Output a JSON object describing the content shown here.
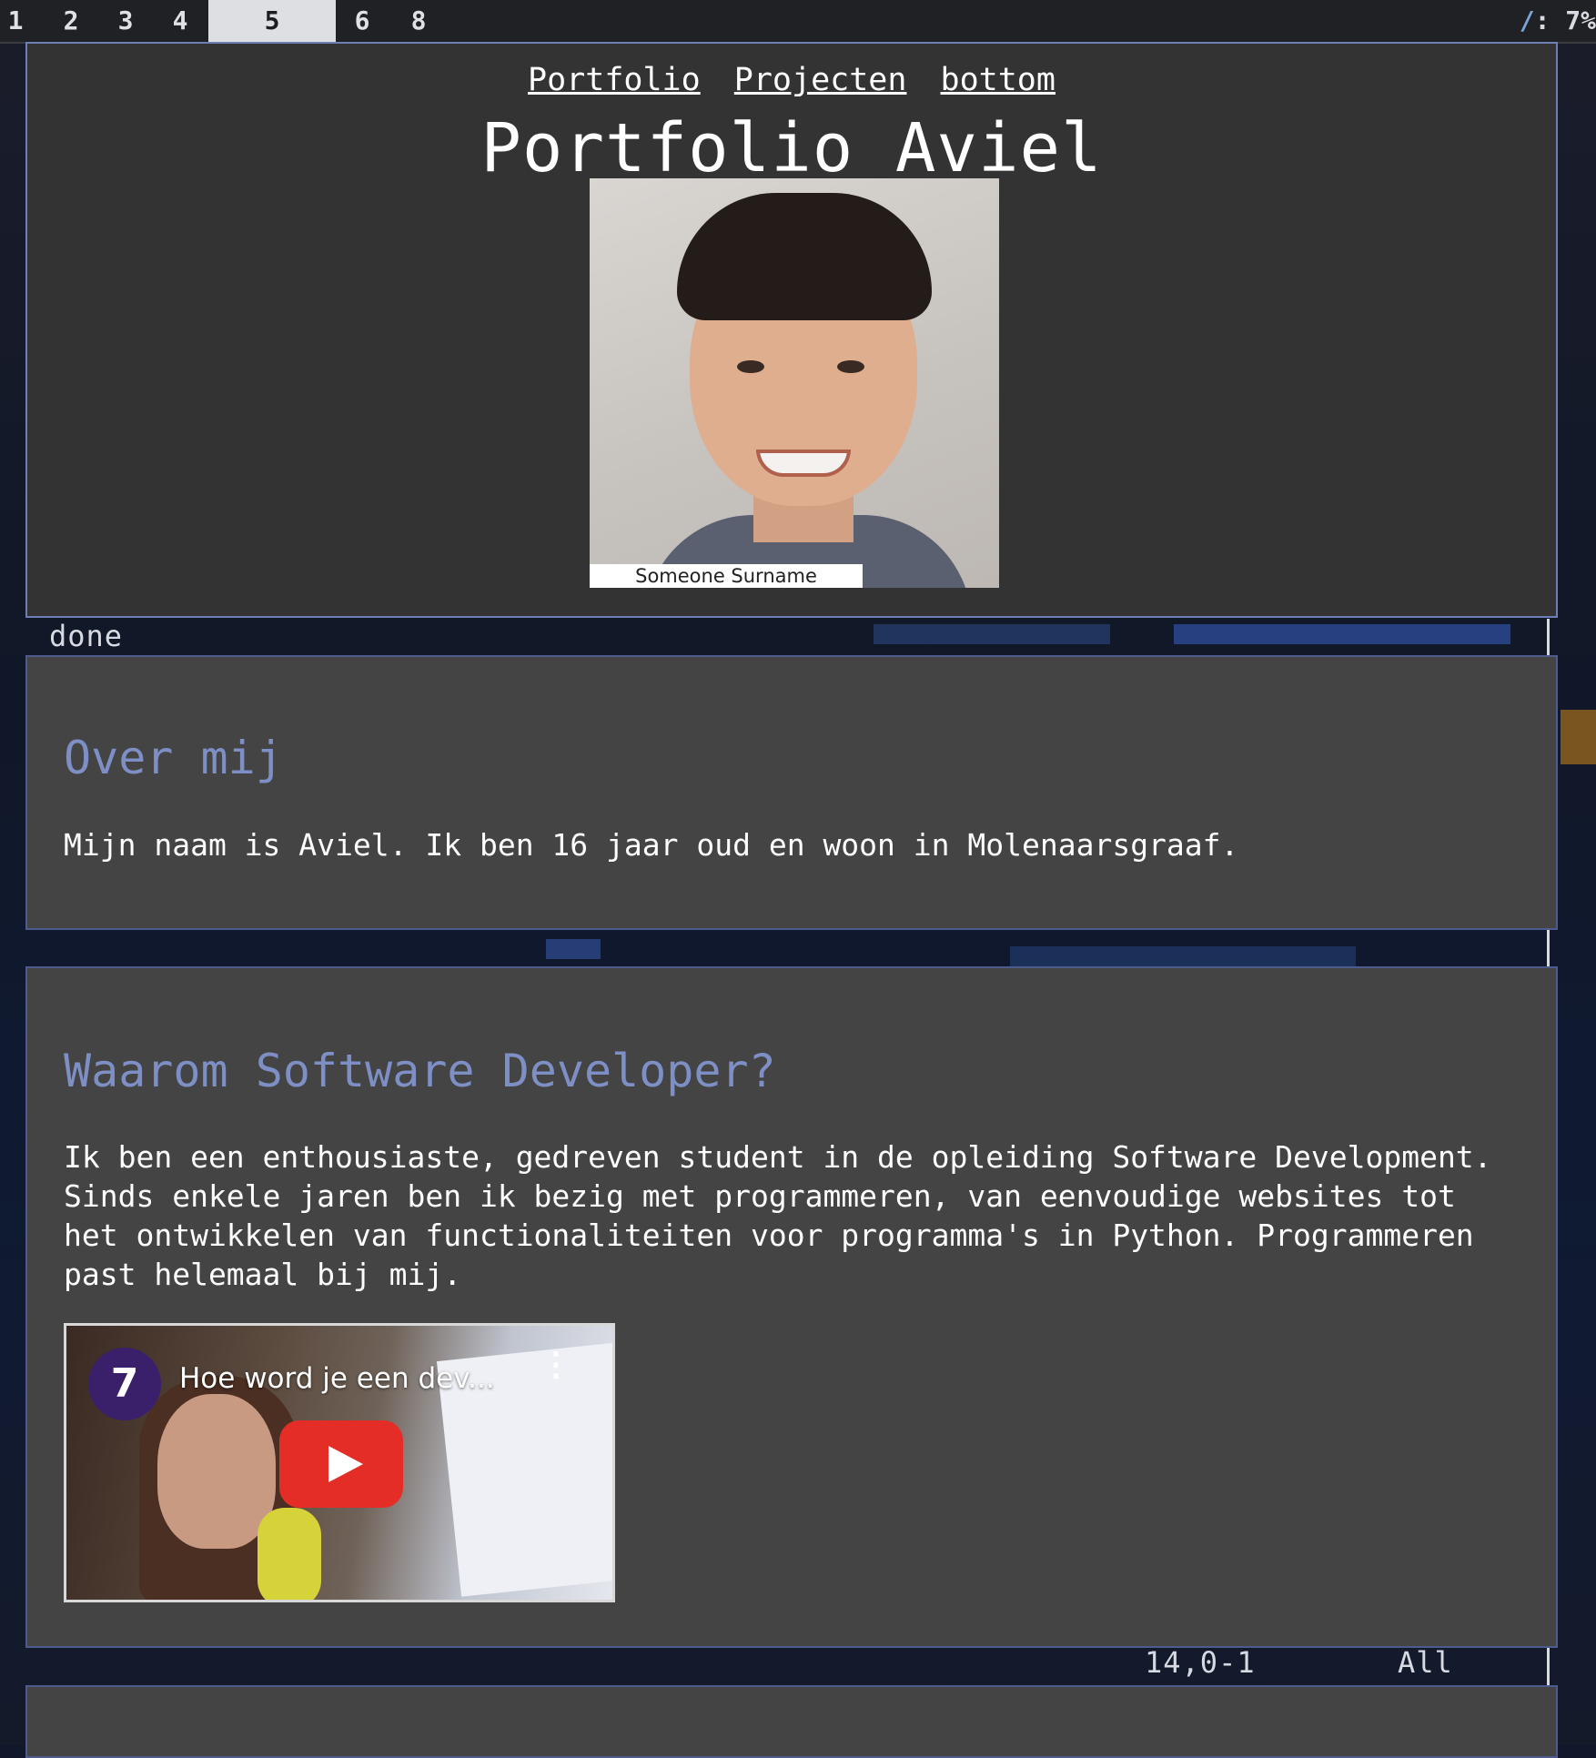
{
  "workspaces": [
    "1",
    "2",
    "3",
    "4",
    "5",
    "6",
    "8"
  ],
  "active_workspace": "5",
  "status_right": {
    "slash": "/",
    "text": ": 7%"
  },
  "terminal": {
    "done": "done",
    "cursor_pos": "14,0-1",
    "scroll": "All"
  },
  "nav": {
    "links": [
      "Portfolio",
      "Projecten",
      "bottom"
    ]
  },
  "page_title": "Portfolio Aviel",
  "photo": {
    "caption": "Someone  Surname"
  },
  "about": {
    "title": "Over mij",
    "body": "Mijn naam is Aviel. Ik ben 16 jaar oud en woon in Molenaarsgraaf."
  },
  "why": {
    "title": "Waarom Software Developer?",
    "body": "Ik ben een enthousiaste, gedreven student in de opleiding Software Development. Sinds enkele jaren ben ik bezig met programmeren, van eenvoudige websites tot het ontwikkelen van functionaliteiten voor programma's in Python. Programmeren past helemaal bij mij."
  },
  "video": {
    "title": "Hoe word je een dev...",
    "channel_glyph": "7"
  },
  "colors": {
    "accent_heading": "#7d8fc4",
    "panel_border": "#6e7fb5",
    "header_bg": "#333333",
    "section_bg": "#444444",
    "youtube_red": "#e52d27"
  },
  "icons": [
    "play-icon",
    "kebab-menu-icon",
    "channel-logo-icon"
  ]
}
